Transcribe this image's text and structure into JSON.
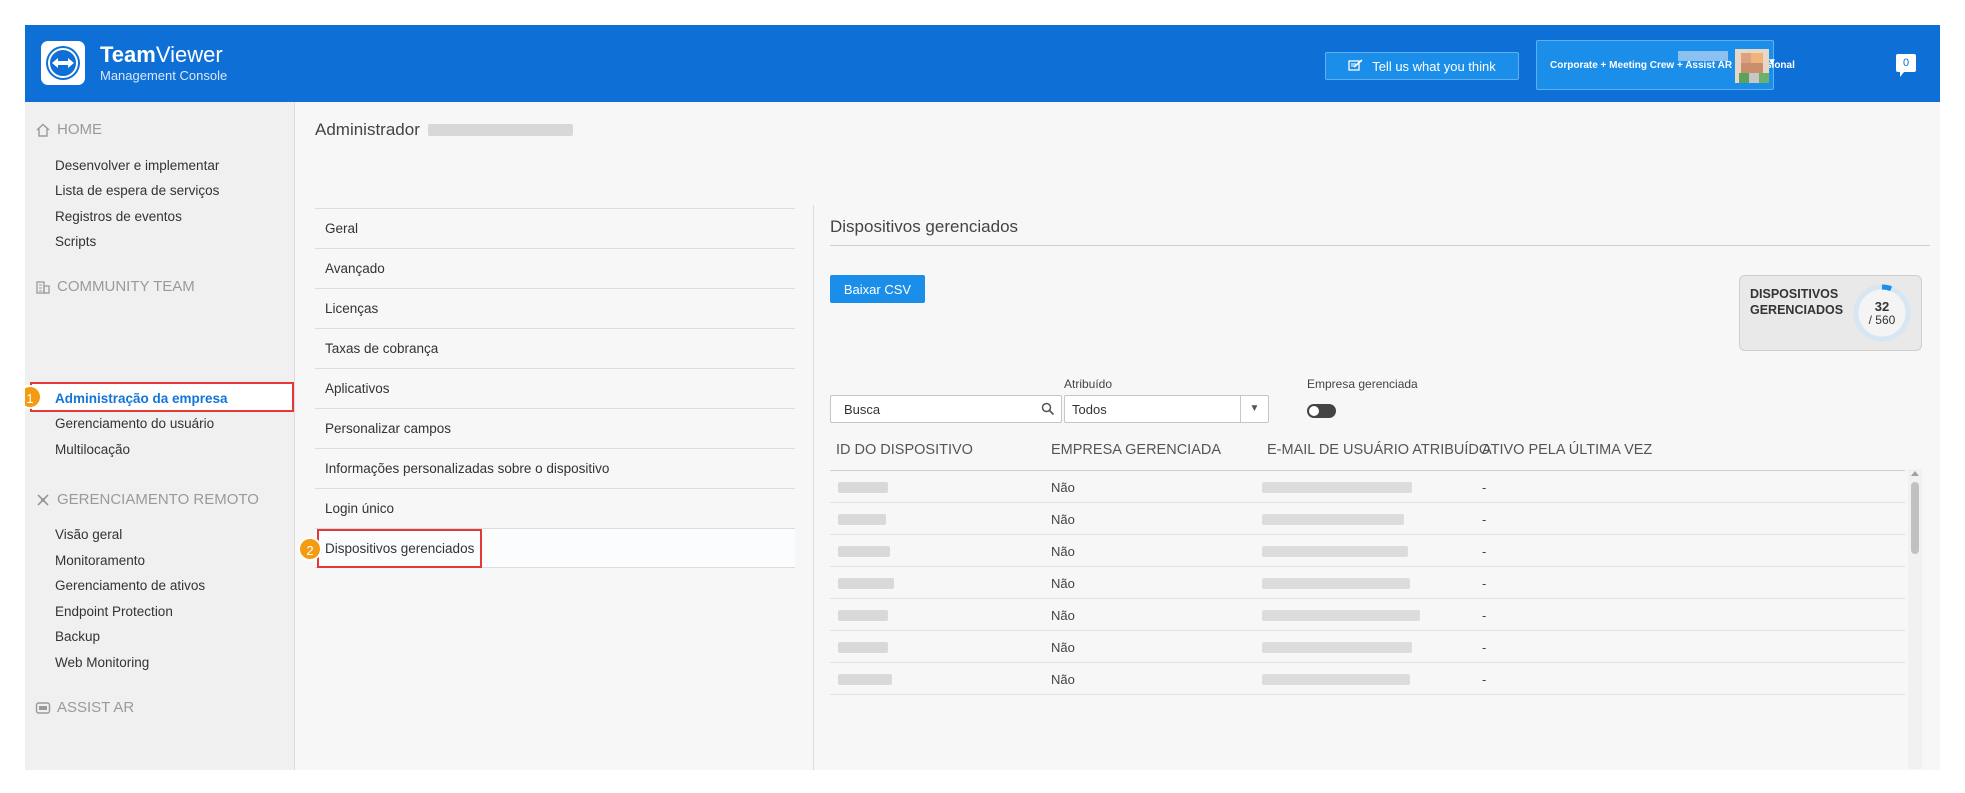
{
  "header": {
    "brand_bold": "Team",
    "brand_rest": "Viewer",
    "brand_sub": "Management Console",
    "feedback_label": "Tell us what you think",
    "license_label": "Corporate + Meeting Crew + Assist AR Professional",
    "notification_count": "0",
    "accent_color": "#0e6fd6"
  },
  "sidebar": {
    "home": {
      "title": "HOME",
      "items": [
        "Desenvolver e implementar",
        "Lista de espera de serviços",
        "Registros de eventos",
        "Scripts"
      ]
    },
    "community": {
      "title": "COMMUNITY TEAM",
      "items": [
        "Administração da empresa",
        "Gerenciamento do usuário",
        "Multilocação"
      ],
      "active_badge": "1"
    },
    "remote": {
      "title": "GERENCIAMENTO REMOTO",
      "items": [
        "Visão geral",
        "Monitoramento",
        "Gerenciamento de ativos",
        "Endpoint Protection",
        "Backup",
        "Web Monitoring"
      ]
    },
    "assist": {
      "title": "ASSIST AR"
    }
  },
  "admin": {
    "title": "Administrador",
    "submenu": [
      "Geral",
      "Avançado",
      "Licenças",
      "Taxas de cobrança",
      "Aplicativos",
      "Personalizar campos",
      "Informações personalizadas sobre o dispositivo",
      "Login único",
      "Dispositivos gerenciados"
    ],
    "active_badge": "2"
  },
  "main": {
    "title": "Dispositivos gerenciados",
    "csv_label": "Baixar CSV",
    "card_label_1": "DISPOSITIVOS",
    "card_label_2": "GERENCIADOS",
    "device_count": "32",
    "device_total": "/ 560",
    "device_fraction": 0.057,
    "search_placeholder": "Busca",
    "assigned_label": "Atribuído",
    "assigned_value": "Todos",
    "managed_label": "Empresa gerenciada",
    "managed_on": false
  },
  "table": {
    "columns": [
      "ID DO DISPOSITIVO",
      "EMPRESA GERENCIADA",
      "E-MAIL DE USUÁRIO ATRIBUÍDO",
      "ATIVO PELA ÚLTIMA VEZ"
    ],
    "rows": [
      {
        "managed": "Não",
        "last_active": "-"
      },
      {
        "managed": "Não",
        "last_active": "-"
      },
      {
        "managed": "Não",
        "last_active": "-"
      },
      {
        "managed": "Não",
        "last_active": "-"
      },
      {
        "managed": "Não",
        "last_active": "-"
      },
      {
        "managed": "Não",
        "last_active": "-"
      },
      {
        "managed": "Não",
        "last_active": "-"
      }
    ]
  }
}
